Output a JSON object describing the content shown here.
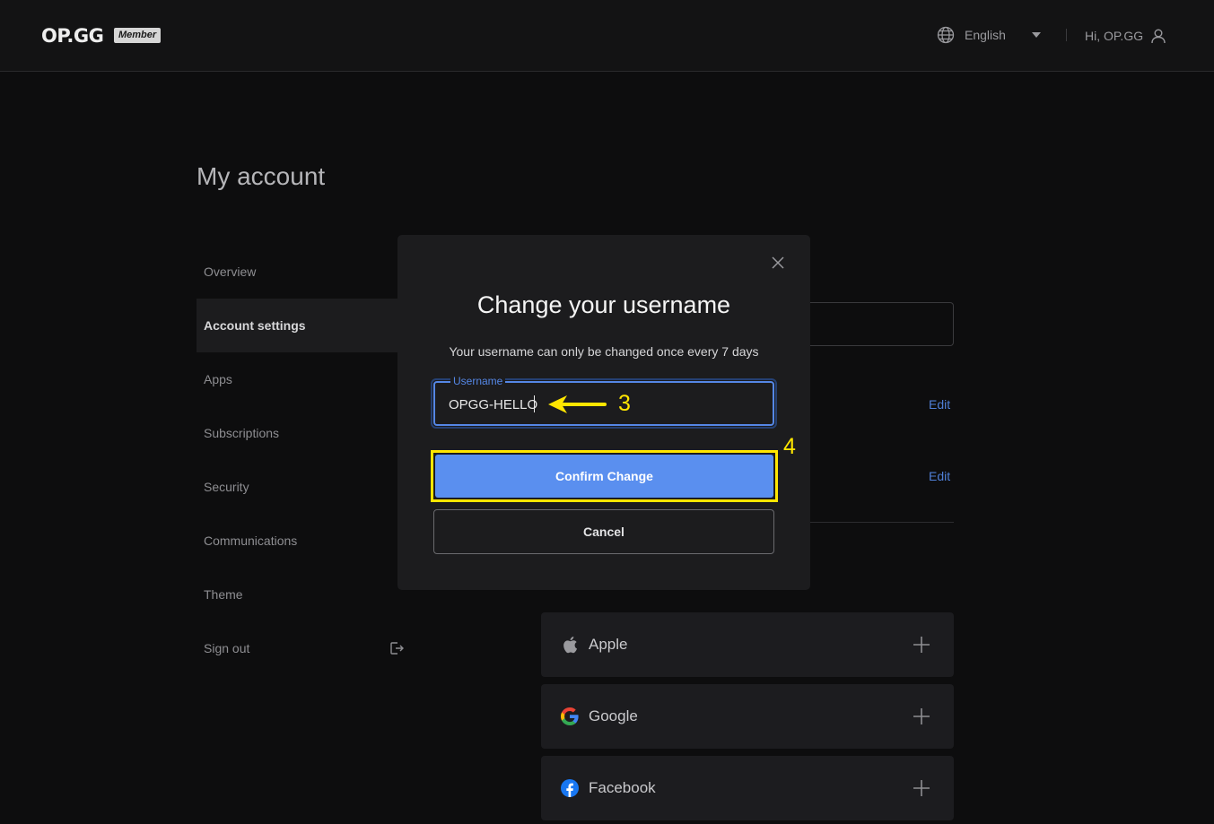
{
  "header": {
    "logo": "OP.GG",
    "badge": "Member",
    "language": "English",
    "greeting": "Hi, OP.GG"
  },
  "page": {
    "title": "My account"
  },
  "sidebar": {
    "items": [
      {
        "label": "Overview",
        "active": false
      },
      {
        "label": "Account settings",
        "active": true
      },
      {
        "label": "Apps",
        "active": false
      },
      {
        "label": "Subscriptions",
        "active": false
      },
      {
        "label": "Security",
        "active": false
      },
      {
        "label": "Communications",
        "active": false
      },
      {
        "label": "Theme",
        "active": false
      },
      {
        "label": "Sign out",
        "active": false
      }
    ]
  },
  "settings": {
    "edit_label": "Edit"
  },
  "providers": [
    {
      "label": "Apple",
      "icon": "apple-icon"
    },
    {
      "label": "Google",
      "icon": "google-icon"
    },
    {
      "label": "Facebook",
      "icon": "facebook-icon"
    }
  ],
  "modal": {
    "title": "Change your username",
    "subtitle": "Your username can only be changed once every 7 days",
    "field_label": "Username",
    "field_value": "OPGG-HELLO",
    "confirm_label": "Confirm Change",
    "cancel_label": "Cancel"
  },
  "annotations": {
    "step_3": "3",
    "step_4": "4",
    "highlight_color": "#ffe600"
  },
  "colors": {
    "accent": "#5a8fef",
    "link": "#4f7fd6",
    "background": "#0d0d0e",
    "panel": "#1c1c1e"
  }
}
